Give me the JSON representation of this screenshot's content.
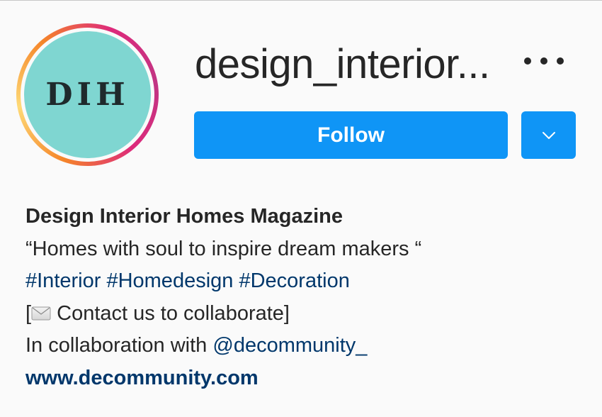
{
  "profile": {
    "username": "design_interior...",
    "avatar_initials": "DIH",
    "avatar_color": "#7fd6d1"
  },
  "actions": {
    "follow_label": "Follow",
    "accent": "#0f95f6"
  },
  "bio": {
    "name": "Design Interior Homes Magazine",
    "tagline": "“Homes with soul to inspire dream makers “",
    "hashtags": [
      "#Interior",
      "#Homedesign",
      "#Decoration"
    ],
    "contact_open": "[",
    "contact_text": " Contact us to collaborate]",
    "collab_prefix": "In collaboration with ",
    "collab_mention": "@decommunity_",
    "website": "www.decommunity.com"
  },
  "icons": {
    "more": "more-horizontal-icon",
    "dropdown": "chevron-down-icon",
    "envelope": "envelope-icon"
  }
}
